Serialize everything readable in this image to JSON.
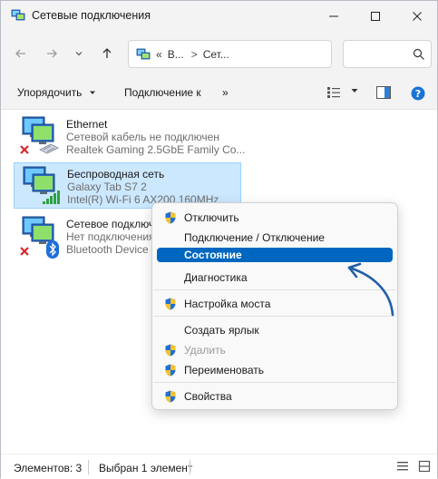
{
  "window": {
    "title": "Сетевые подключения"
  },
  "address": {
    "prefix": "«",
    "crumb1": "В...",
    "separator": ">",
    "crumb2": "Сет..."
  },
  "commandbar": {
    "organize": "Упорядочить",
    "connect": "Подключение к",
    "more": "»"
  },
  "connections": [
    {
      "name": "Ethernet",
      "status": "Сетевой кабель не подключен",
      "device": "Realtek Gaming 2.5GbE Family Co..."
    },
    {
      "name": "Беспроводная сеть",
      "status": "Galaxy Tab S7 2",
      "device": "Intel(R) Wi-Fi 6 AX200 160MHz"
    },
    {
      "name": "Сетевое подключ...",
      "status": "Нет подключения",
      "device": "Bluetooth Device"
    }
  ],
  "context_menu": {
    "items": [
      {
        "label": "Отключить",
        "shield": true,
        "disabled": false,
        "highlighted": false
      },
      {
        "label": "Подключение / Отключение",
        "shield": false,
        "disabled": false,
        "highlighted": false
      },
      {
        "label": "Состояние",
        "shield": false,
        "disabled": false,
        "highlighted": true
      },
      {
        "label": "Диагностика",
        "shield": false,
        "disabled": false,
        "highlighted": false
      },
      {
        "label": "Настройка моста",
        "shield": true,
        "disabled": false,
        "highlighted": false
      },
      {
        "label": "Создать ярлык",
        "shield": false,
        "disabled": false,
        "highlighted": false
      },
      {
        "label": "Удалить",
        "shield": true,
        "disabled": true,
        "highlighted": false
      },
      {
        "label": "Переименовать",
        "shield": true,
        "disabled": false,
        "highlighted": false
      },
      {
        "label": "Свойства",
        "shield": true,
        "disabled": false,
        "highlighted": false
      }
    ]
  },
  "statusbar": {
    "count": "Элементов: 3",
    "selected": "Выбран 1 элемент"
  },
  "colors": {
    "accent": "#0067c0",
    "selection_bg": "#cce8ff",
    "annotation_arrow": "#1f5fa8",
    "error_red": "#d9262c",
    "bluetooth_blue": "#1e6fd9"
  }
}
